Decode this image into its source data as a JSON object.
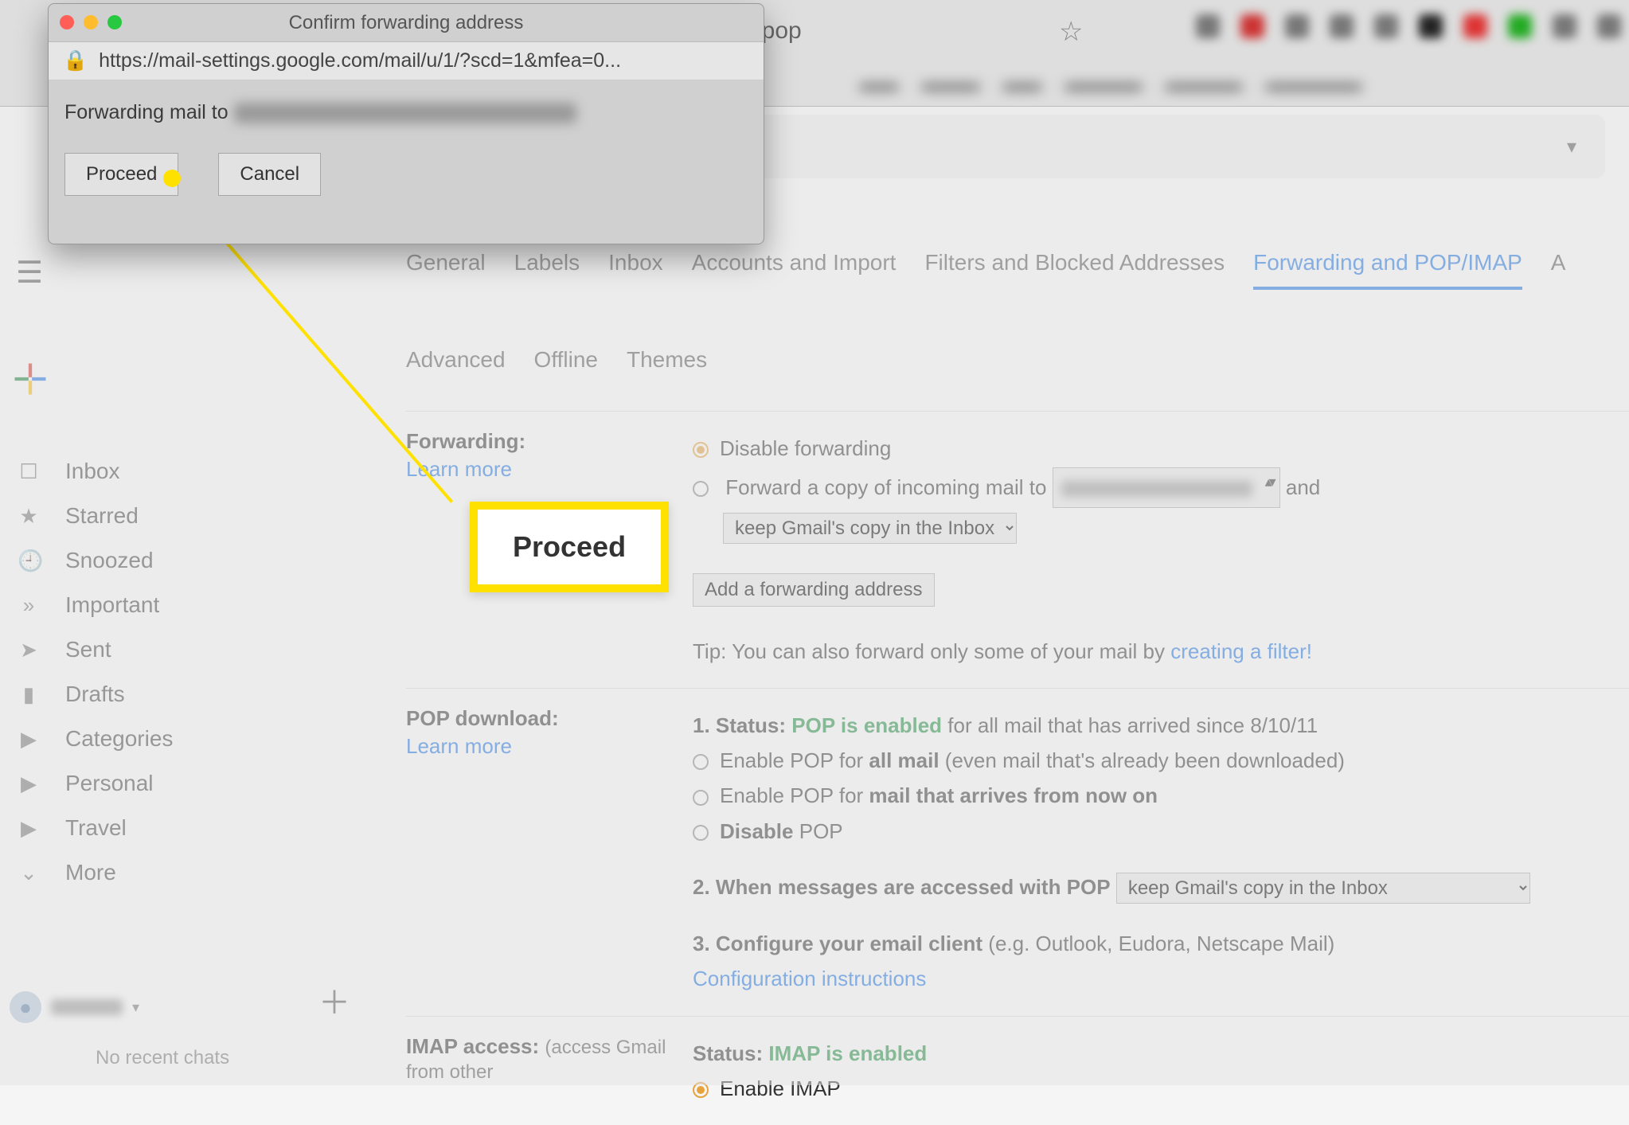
{
  "chrome": {
    "partial_tab_text": "dpop"
  },
  "dialog": {
    "title": "Confirm forwarding address",
    "url": "https://mail-settings.google.com/mail/u/1/?scd=1&mfea=0...",
    "body_prefix": "Forwarding mail to",
    "proceed": "Proceed",
    "cancel": "Cancel"
  },
  "annotation": {
    "callout": "Proceed"
  },
  "sidebar": {
    "items": [
      {
        "label": "Inbox",
        "icon": "☐"
      },
      {
        "label": "Starred",
        "icon": "★"
      },
      {
        "label": "Snoozed",
        "icon": "🕘"
      },
      {
        "label": "Important",
        "icon": "»"
      },
      {
        "label": "Sent",
        "icon": "➤"
      },
      {
        "label": "Drafts",
        "icon": "▮"
      },
      {
        "label": "Categories",
        "icon": "▶"
      },
      {
        "label": "Personal",
        "icon": "▶"
      },
      {
        "label": "Travel",
        "icon": "▶"
      },
      {
        "label": "More",
        "icon": "⌄"
      }
    ],
    "no_chats": "No recent chats"
  },
  "tabs": [
    "General",
    "Labels",
    "Inbox",
    "Accounts and Import",
    "Filters and Blocked Addresses",
    "Forwarding and POP/IMAP",
    "A",
    "Advanced",
    "Offline",
    "Themes"
  ],
  "active_tab": "Forwarding and POP/IMAP",
  "forwarding": {
    "label": "Forwarding:",
    "learn_more": "Learn more",
    "disable": "Disable forwarding",
    "forward_copy_prefix": "Forward a copy of incoming mail to",
    "and": "and",
    "keep_copy": "keep Gmail's copy in the Inbox",
    "add_btn": "Add a forwarding address",
    "tip_prefix": "Tip: You can also forward only some of your mail by ",
    "tip_link": "creating a filter!"
  },
  "pop": {
    "label": "POP download:",
    "learn_more": "Learn more",
    "status_prefix": "1. Status: ",
    "status_green": "POP is enabled",
    "status_suffix": " for all mail that has arrived since 8/10/11",
    "enable_all_prefix": "Enable POP for ",
    "enable_all_bold": "all mail",
    "enable_all_suffix": " (even mail that's already been downloaded)",
    "enable_now_prefix": "Enable POP for ",
    "enable_now_bold": "mail that arrives from now on",
    "disable_bold": "Disable",
    "disable_rest": " POP",
    "when_prefix": "2. When messages are accessed with POP",
    "keep_copy": "keep Gmail's copy in the Inbox",
    "configure_prefix": "3. Configure your email client",
    "configure_rest": " (e.g. Outlook, Eudora, Netscape Mail)",
    "config_link": "Configuration instructions"
  },
  "imap": {
    "label": "IMAP access:",
    "sub": "(access Gmail from other",
    "status_prefix": "Status: ",
    "status_green": "IMAP is enabled",
    "enable": "Enable IMAP"
  }
}
